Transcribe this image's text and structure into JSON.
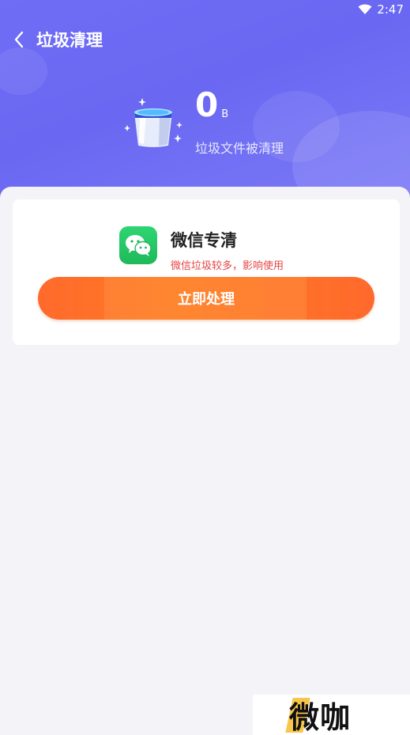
{
  "status_bar": {
    "time": "2:47"
  },
  "header": {
    "title": "垃圾清理",
    "cleaned_amount": "0",
    "cleaned_unit": "B",
    "cleaned_desc": "垃圾文件被清理"
  },
  "card": {
    "app_name": "微信专清",
    "warning": "微信垃圾较多，影响使用",
    "action_label": "立即处理"
  },
  "watermark": {
    "text": "微咖"
  },
  "colors": {
    "header_gradient_start": "#6f6cf5",
    "header_gradient_end": "#7c7af6",
    "action_orange": "#ff6a2c",
    "warning_red": "#e54545",
    "wechat_green": "#2ed573"
  }
}
